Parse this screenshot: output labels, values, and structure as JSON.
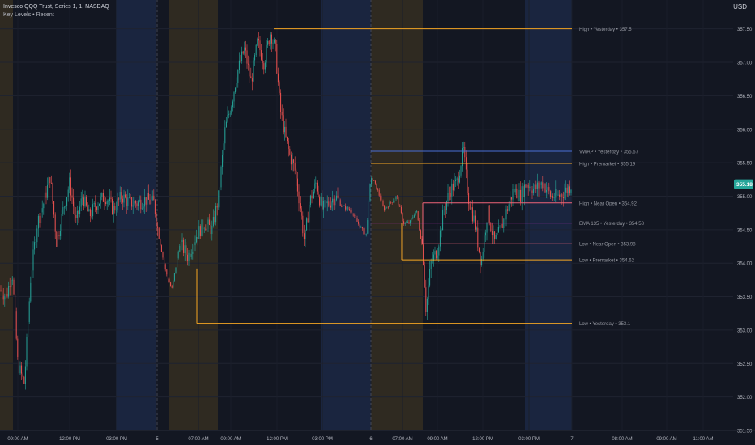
{
  "header": {
    "symbol_line": "Invesco QQQ Trust, Series 1, 1, NASDAQ",
    "indicator_line": "Key Levels • Recent"
  },
  "currency": "USD",
  "chart_data": {
    "type": "candlestick",
    "title": "",
    "ylim": [
      351.5,
      357.75
    ],
    "y_ticks": [
      "351.50",
      "352.00",
      "352.50",
      "353.00",
      "353.50",
      "354.00",
      "354.50",
      "355.00",
      "355.50",
      "356.00",
      "356.50",
      "357.00",
      "357.50"
    ],
    "x_ticks": [
      "09:00 AM",
      "12:00 PM",
      "03:00 PM",
      "5",
      "07:00 AM",
      "09:00 AM",
      "12:00 PM",
      "03:00 PM",
      "6",
      "07:00 AM",
      "09:00 AM",
      "12:00 PM",
      "03:00 PM",
      "7",
      "08:00 AM",
      "09:00 AM",
      "11:00 AM"
    ],
    "current_price": "355.18",
    "current_price_value": 355.18,
    "session_shading": [
      {
        "kind": "premarket",
        "from": "09:00 AM",
        "to": "09:30 AM",
        "color": "#3a3222"
      },
      {
        "kind": "postmarket",
        "from": "04:00 PM",
        "to": "06:00 PM",
        "color": "#1e2b4a"
      },
      {
        "kind": "premarket",
        "from": "5 · 04:00 AM",
        "to": "5 · 09:30 AM",
        "color": "#3a3222"
      },
      {
        "kind": "postmarket",
        "from": "5 · 04:00 PM",
        "to": "5 · 06:00 PM",
        "color": "#1e2b4a"
      },
      {
        "kind": "premarket",
        "from": "6 · 04:00 AM",
        "to": "6 · 09:30 AM",
        "color": "#3a3222"
      },
      {
        "kind": "postmarket",
        "from": "6 · 04:00 PM",
        "to": "6 · 06:00 PM",
        "color": "#1e2b4a"
      }
    ],
    "levels": [
      {
        "label": "High • Yesterday • 357.5",
        "value": 357.5,
        "color": "#f5a623"
      },
      {
        "label": "VWAP • Yesterday • 355.67",
        "value": 355.67,
        "color": "#4a6fd6"
      },
      {
        "label": "High • Premarket • 355.19",
        "value": 355.49,
        "color": "#f5a623"
      },
      {
        "label": "High • Near Open • 354.92",
        "value": 354.9,
        "color": "#f06478"
      },
      {
        "label": "EMA 135 • Yesterday • 354.58",
        "value": 354.6,
        "color": "#d633d6"
      },
      {
        "label": "Low • Near Open • 353.98",
        "value": 354.29,
        "color": "#f06478"
      },
      {
        "label": "Low • Premarket • 354.62",
        "value": 354.05,
        "color": "#f5a623"
      },
      {
        "label": "Low • Yesterday • 353.1",
        "value": 353.1,
        "color": "#f5a623"
      }
    ],
    "price_path": [
      [
        0,
        353.6
      ],
      [
        8,
        353.5
      ],
      [
        15,
        353.9
      ],
      [
        22,
        352.5
      ],
      [
        30,
        352.2
      ],
      [
        38,
        353.8
      ],
      [
        46,
        354.6
      ],
      [
        54,
        354.9
      ],
      [
        62,
        355.3
      ],
      [
        70,
        354.3
      ],
      [
        78,
        354.8
      ],
      [
        86,
        355.2
      ],
      [
        94,
        354.6
      ],
      [
        102,
        355.0
      ],
      [
        110,
        354.7
      ],
      [
        120,
        354.9
      ],
      [
        130,
        355.0
      ],
      [
        140,
        354.8
      ],
      [
        150,
        355.0
      ],
      [
        160,
        354.9
      ],
      [
        170,
        354.9
      ],
      [
        180,
        354.95
      ],
      [
        190,
        354.9
      ],
      [
        196,
        354.4
      ],
      [
        204,
        353.9
      ],
      [
        212,
        353.6
      ],
      [
        222,
        354.3
      ],
      [
        232,
        354.1
      ],
      [
        242,
        354.4
      ],
      [
        252,
        354.6
      ],
      [
        262,
        354.5
      ],
      [
        270,
        355.0
      ],
      [
        278,
        356.0
      ],
      [
        286,
        356.4
      ],
      [
        294,
        356.9
      ],
      [
        302,
        357.2
      ],
      [
        310,
        356.7
      ],
      [
        318,
        357.3
      ],
      [
        326,
        357.0
      ],
      [
        334,
        357.45
      ],
      [
        340,
        357.2
      ],
      [
        346,
        356.3
      ],
      [
        352,
        355.9
      ],
      [
        358,
        355.6
      ],
      [
        364,
        355.4
      ],
      [
        370,
        354.9
      ],
      [
        376,
        354.3
      ],
      [
        382,
        354.9
      ],
      [
        390,
        355.2
      ],
      [
        398,
        354.8
      ],
      [
        406,
        354.9
      ],
      [
        414,
        355.0
      ],
      [
        422,
        354.85
      ],
      [
        432,
        354.8
      ],
      [
        442,
        354.6
      ],
      [
        452,
        354.4
      ],
      [
        458,
        355.3
      ],
      [
        466,
        355.1
      ],
      [
        474,
        354.8
      ],
      [
        482,
        354.9
      ],
      [
        490,
        355.0
      ],
      [
        498,
        354.6
      ],
      [
        506,
        354.6
      ],
      [
        514,
        354.8
      ],
      [
        522,
        354.2
      ],
      [
        526,
        353.3
      ],
      [
        532,
        354.0
      ],
      [
        540,
        354.2
      ],
      [
        548,
        354.8
      ],
      [
        556,
        355.1
      ],
      [
        564,
        355.2
      ],
      [
        572,
        355.7
      ],
      [
        578,
        355.0
      ],
      [
        586,
        354.6
      ],
      [
        594,
        354.0
      ],
      [
        602,
        354.8
      ],
      [
        610,
        354.3
      ],
      [
        618,
        354.5
      ],
      [
        626,
        354.8
      ],
      [
        634,
        355.1
      ],
      [
        642,
        355.0
      ],
      [
        650,
        355.2
      ],
      [
        660,
        355.1
      ],
      [
        670,
        355.2
      ],
      [
        680,
        355.0
      ],
      [
        690,
        355.0
      ],
      [
        700,
        355.1
      ],
      [
        706,
        355.18
      ]
    ]
  }
}
